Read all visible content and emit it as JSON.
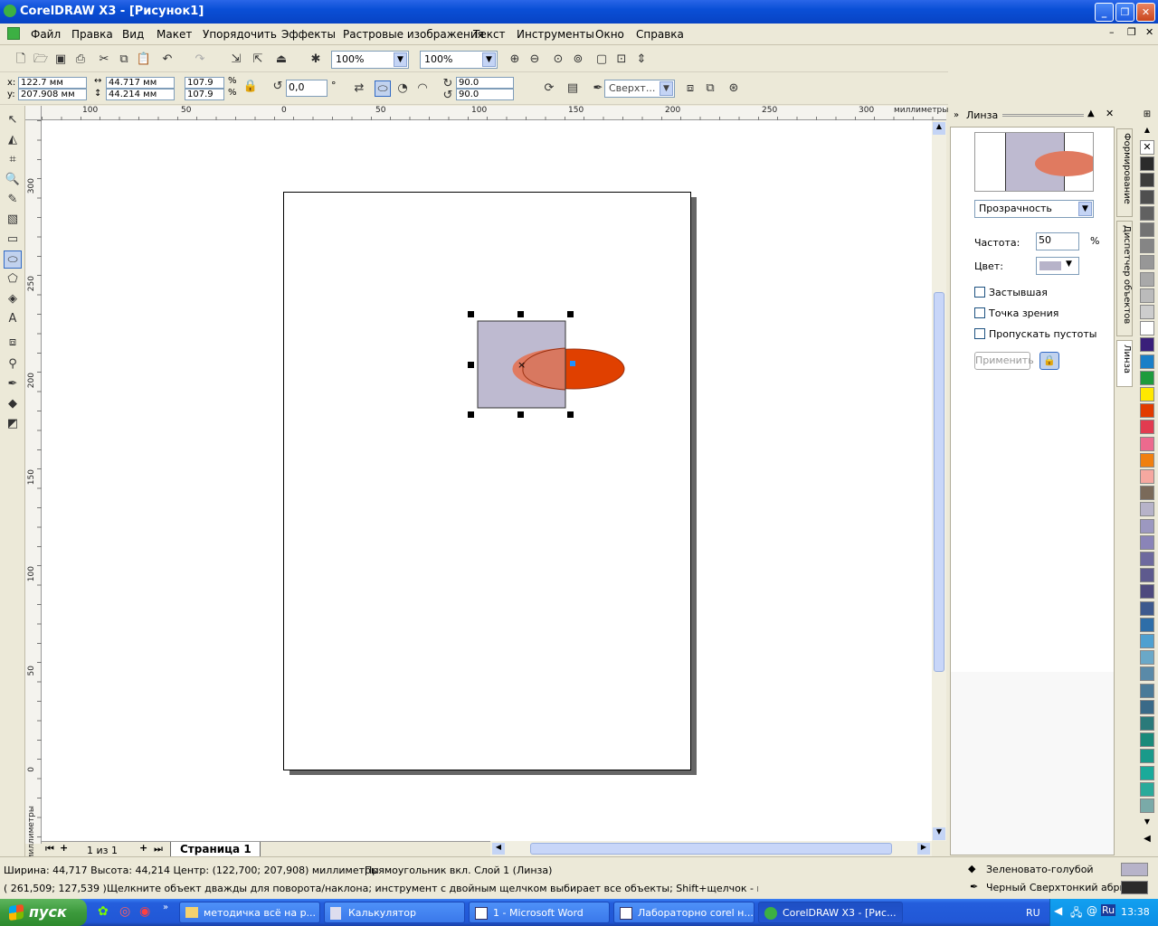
{
  "app": {
    "title": "CorelDRAW X3 - [Рисунок1]"
  },
  "menu": [
    "Файл",
    "Правка",
    "Вид",
    "Макет",
    "Упорядочить",
    "Эффекты",
    "Растровые изображения",
    "Текст",
    "Инструменты",
    "Окно",
    "Справка"
  ],
  "toolbar": {
    "zoom1": "100%",
    "zoom2": "100%"
  },
  "props": {
    "x": "122.7 мм",
    "y": "207.908 мм",
    "w": "44.717 мм",
    "h": "44.214 мм",
    "sx": "107.9",
    "sy": "107.9",
    "pct": "%",
    "angle": "0,0",
    "deg": "°",
    "a1": "90.0",
    "a2": "90.0",
    "wrap": "Сверхт..."
  },
  "ruler": {
    "h": [
      "100",
      "50",
      "0",
      "50",
      "100",
      "150",
      "200",
      "250",
      "300"
    ],
    "units": "миллиметры",
    "v": [
      "300",
      "250",
      "200",
      "150",
      "100",
      "50",
      "0"
    ]
  },
  "pages": {
    "count": "1 из 1",
    "tab": "Страница 1"
  },
  "docker": {
    "title": "Линза",
    "lens_type": "Прозрачность",
    "rate_label": "Частота:",
    "rate_value": "50",
    "pct": "%",
    "color_label": "Цвет:",
    "frozen": "Застывшая",
    "viewpoint": "Точка зрения",
    "skip_empty": "Пропускать пустоты",
    "apply": "Применить",
    "tabs": [
      "Формирование",
      "Диспетчер объектов",
      "Линза"
    ]
  },
  "palette": [
    "#FFFFFF",
    "#2B2B2B",
    "#3D3D3D",
    "#4F4F4F",
    "#616161",
    "#737373",
    "#858585",
    "#979797",
    "#A9A9A9",
    "#BBBBBB",
    "#CDCDCD",
    "#FFFFFF",
    "#3A1F7A",
    "#1A7FC7",
    "#1E9B3C",
    "#FFE800",
    "#E23B00",
    "#E23B50",
    "#EC6A8E",
    "#F08010",
    "#F6A8A0",
    "#7A6A5A",
    "#B7B3C9",
    "#9C98C0",
    "#8A84B8",
    "#6E6A9E",
    "#5E5A8E",
    "#4E4A7E",
    "#3E5A8E",
    "#2E6EA8",
    "#4EA0D0",
    "#6AA8C8",
    "#5A8AA8",
    "#4A7A98",
    "#3A6A88",
    "#2A7A7A",
    "#1A8A7A",
    "#1A9A8A",
    "#1AAA9A",
    "#2AAA9A",
    "#7AAAA8"
  ],
  "status": {
    "size": "Ширина: 44,717  Высота: 44,214  Центр: (122,700; 207,908)  миллиметры",
    "object": "Прямоугольник вкл. Слой 1  (Линза)",
    "coords": "( 261,509; 127,539 )",
    "hint": "Щелкните объект дважды для поворота/наклона; инструмент с двойным щелчком выбирает все объекты; Shift+щелчок - выбор нескол...",
    "fill_name": "Зеленовато-голубой",
    "outline_name": "Черный  Сверхтонкий абрис",
    "fill_color": "#B7B3C9",
    "outline_color": "#2B2B2B"
  },
  "taskbar": {
    "start": "пуск",
    "tasks": [
      "методичка всё на р...",
      "Калькулятор",
      "1 - Microsoft Word",
      "Лабораторно corel н...",
      "CorelDRAW X3 - [Рис..."
    ],
    "lang": "RU",
    "time": "13:38"
  },
  "shapes": {
    "rect_color": "#BEBAD0",
    "ellipse_color": "#E04000",
    "lens_overlap": "#E07A60"
  }
}
